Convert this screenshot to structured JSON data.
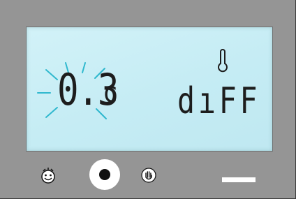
{
  "display": {
    "value": "0.3",
    "unit": "c",
    "parameter": "dıFF",
    "value_blinking": true,
    "indicator_icon": "thermometer-icon"
  },
  "controls": {
    "left_icon": "face-icon",
    "center_icon": "record-dot-icon",
    "right_icon": "hand-icon",
    "bar_icon": "dash-bar"
  },
  "colors": {
    "panel": "#959595",
    "lcd": "#c9eef5",
    "segment": "#1d1d1d",
    "blink_rays": "#2fb8ce"
  }
}
